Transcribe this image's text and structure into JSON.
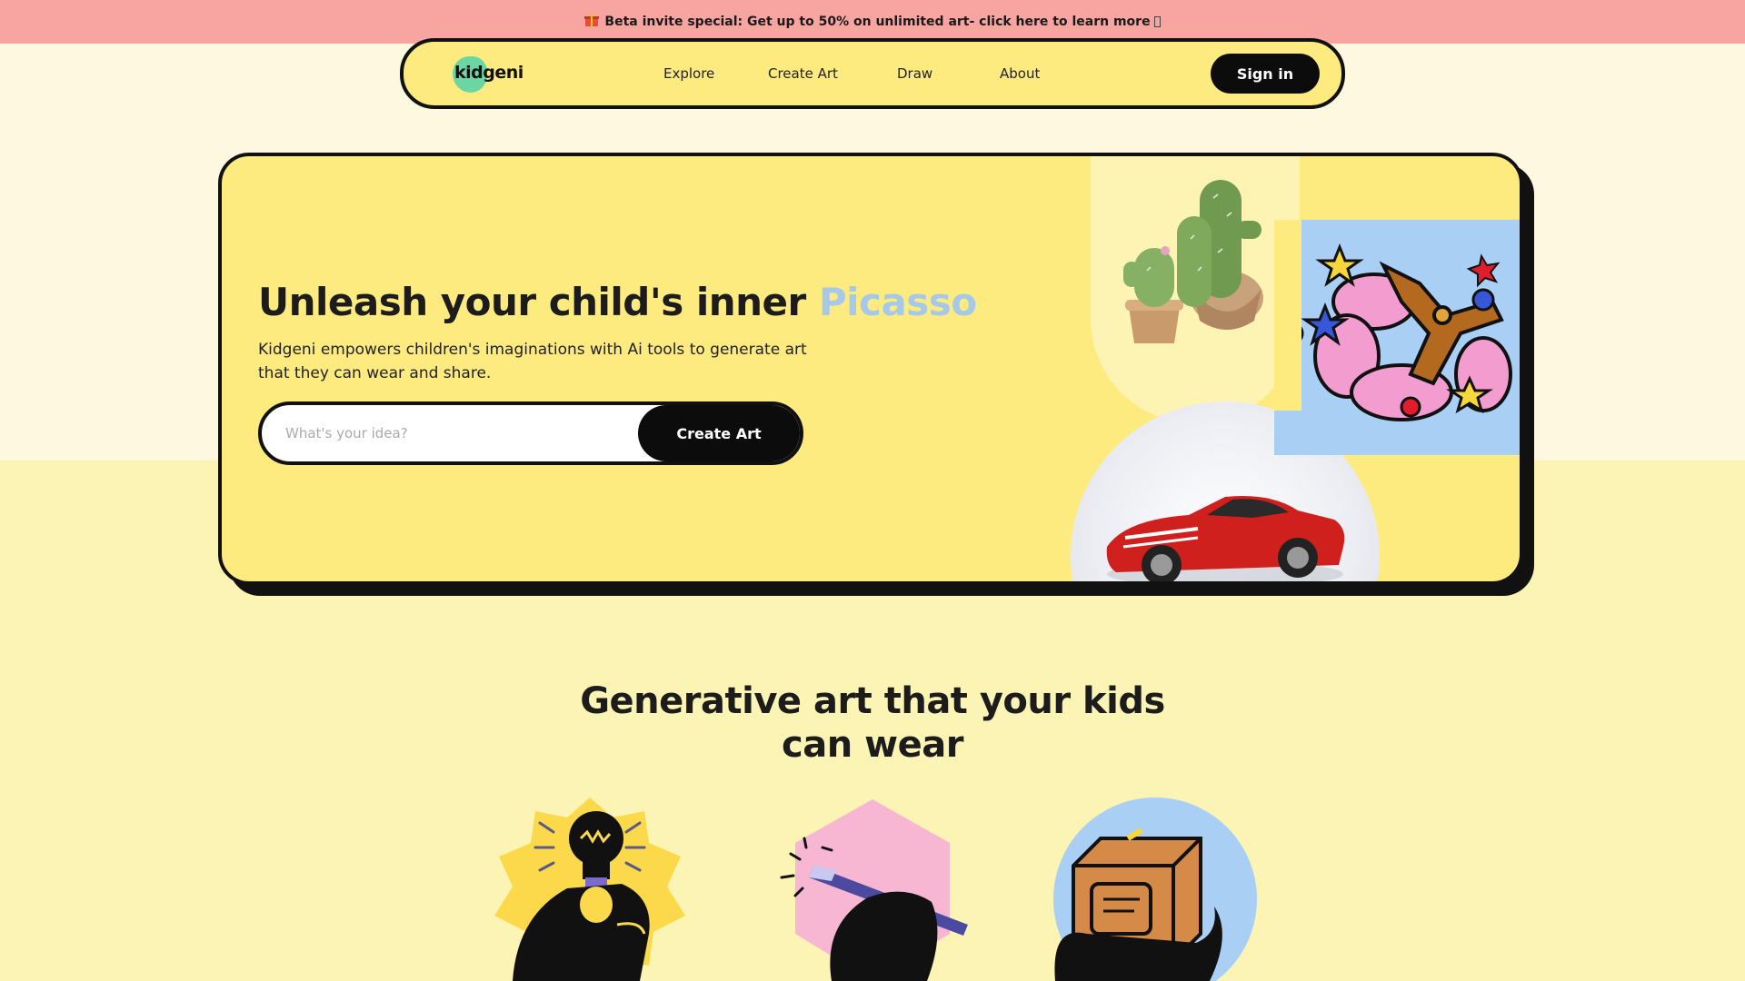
{
  "promo": {
    "icon": "gift-icon",
    "text": "Beta invite special: Get up to 50% on unlimited art- click here to learn more",
    "background": "#f8a5a2"
  },
  "nav": {
    "logo_text": "kidgeni",
    "links": [
      "Explore",
      "Create Art",
      "Draw",
      "About"
    ],
    "signin_label": "Sign in",
    "background": "#fdeb80"
  },
  "hero": {
    "title_prefix": "Unleash your child's inner ",
    "title_accent": "Picasso",
    "description": "Kidgeni empowers children's imaginations with Ai tools to generate art that they can wear and share.",
    "input_placeholder": "What's your idea?",
    "input_value": "",
    "cta_label": "Create Art",
    "images": [
      "cactus-plant-image",
      "balloon-dog-art-image",
      "red-sports-car-image"
    ],
    "accent_color": "#a6c9ea"
  },
  "section": {
    "title_line1": "Generative art that your kids",
    "title_line2": "can wear",
    "features": [
      {
        "icon": "lightbulb-hand-icon",
        "color": "#fcd94a"
      },
      {
        "icon": "pencil-hand-icon",
        "color": "#f7b6d2"
      },
      {
        "icon": "package-hand-icon",
        "color": "#a9cff5"
      }
    ]
  }
}
